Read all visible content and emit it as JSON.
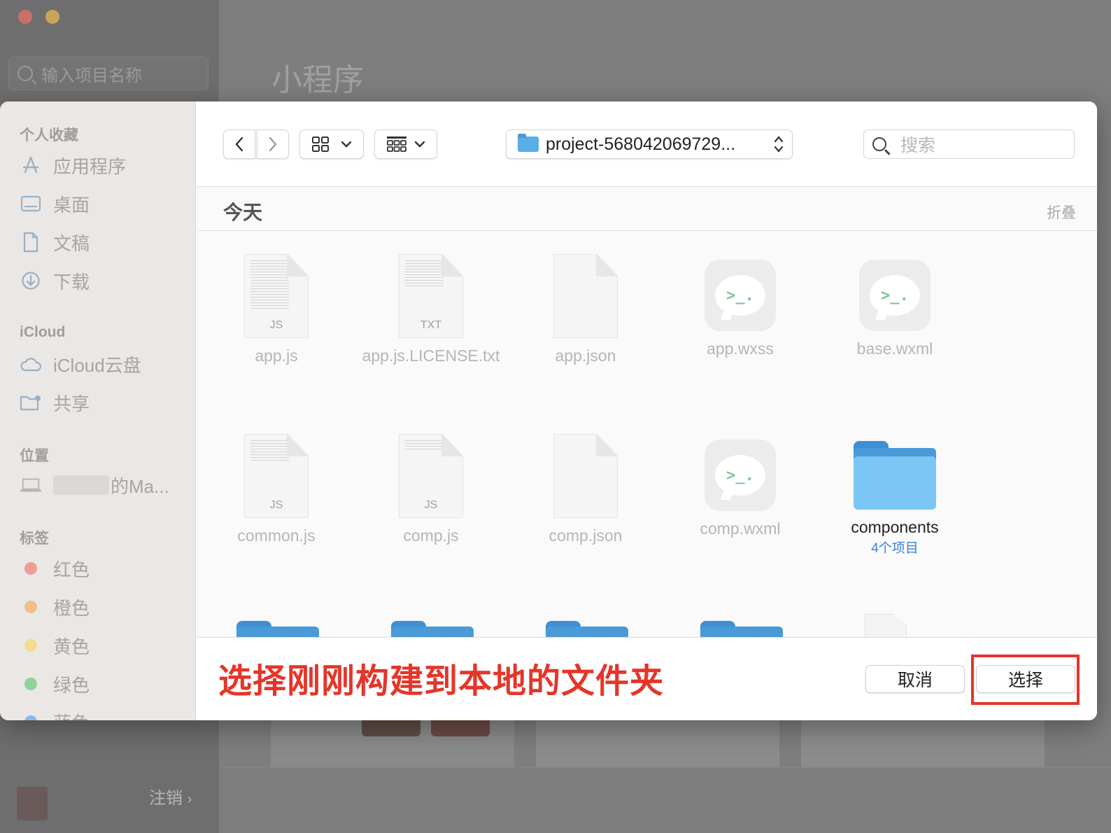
{
  "background": {
    "search_placeholder": "输入项目名称",
    "page_title": "小程序",
    "logout_label": "注销",
    "logout_chevron": "›"
  },
  "sidebar": {
    "favorites_title": "个人收藏",
    "favorites": [
      {
        "label": "应用程序",
        "icon": "applications-icon"
      },
      {
        "label": "桌面",
        "icon": "desktop-icon"
      },
      {
        "label": "文稿",
        "icon": "document-icon"
      },
      {
        "label": "下载",
        "icon": "download-icon"
      }
    ],
    "icloud_title": "iCloud",
    "icloud": [
      {
        "label": "iCloud云盘",
        "icon": "cloud-icon"
      },
      {
        "label": "共享",
        "icon": "shared-folder-icon"
      }
    ],
    "locations_title": "位置",
    "location_label": "的Ma...",
    "tags_title": "标签",
    "tags": [
      {
        "label": "红色",
        "color": "#ef9e97"
      },
      {
        "label": "橙色",
        "color": "#f0c08a"
      },
      {
        "label": "黄色",
        "color": "#f3dc8f"
      },
      {
        "label": "绿色",
        "color": "#8fd29a"
      },
      {
        "label": "蓝色",
        "color": "#8ab8f0"
      }
    ]
  },
  "toolbar": {
    "back": "‹",
    "forward": "›",
    "path_label": "project-568042069729...",
    "search_placeholder": "搜索"
  },
  "group": {
    "title": "今天",
    "collapse_label": "折叠"
  },
  "files": [
    {
      "name": "app.js",
      "kind": "doc",
      "ext": "JS"
    },
    {
      "name": "app.js.LICENSE.txt",
      "kind": "doc",
      "ext": "TXT"
    },
    {
      "name": "app.json",
      "kind": "doc",
      "ext": ""
    },
    {
      "name": "app.wxss",
      "kind": "wx",
      "ext": ""
    },
    {
      "name": "base.wxml",
      "kind": "wx",
      "ext": ""
    },
    {
      "name": "common.js",
      "kind": "doc",
      "ext": "JS"
    },
    {
      "name": "comp.js",
      "kind": "doc",
      "ext": "JS"
    },
    {
      "name": "comp.json",
      "kind": "doc",
      "ext": ""
    },
    {
      "name": "comp.wxml",
      "kind": "wx",
      "ext": ""
    },
    {
      "name": "components",
      "kind": "folder",
      "ext": "",
      "sub": "4个项目"
    }
  ],
  "wx_glyph": ">_.",
  "footer": {
    "annotation": "选择刚刚构建到本地的文件夹",
    "cancel_label": "取消",
    "choose_label": "选择",
    "highlight_color": "#e5352a"
  }
}
